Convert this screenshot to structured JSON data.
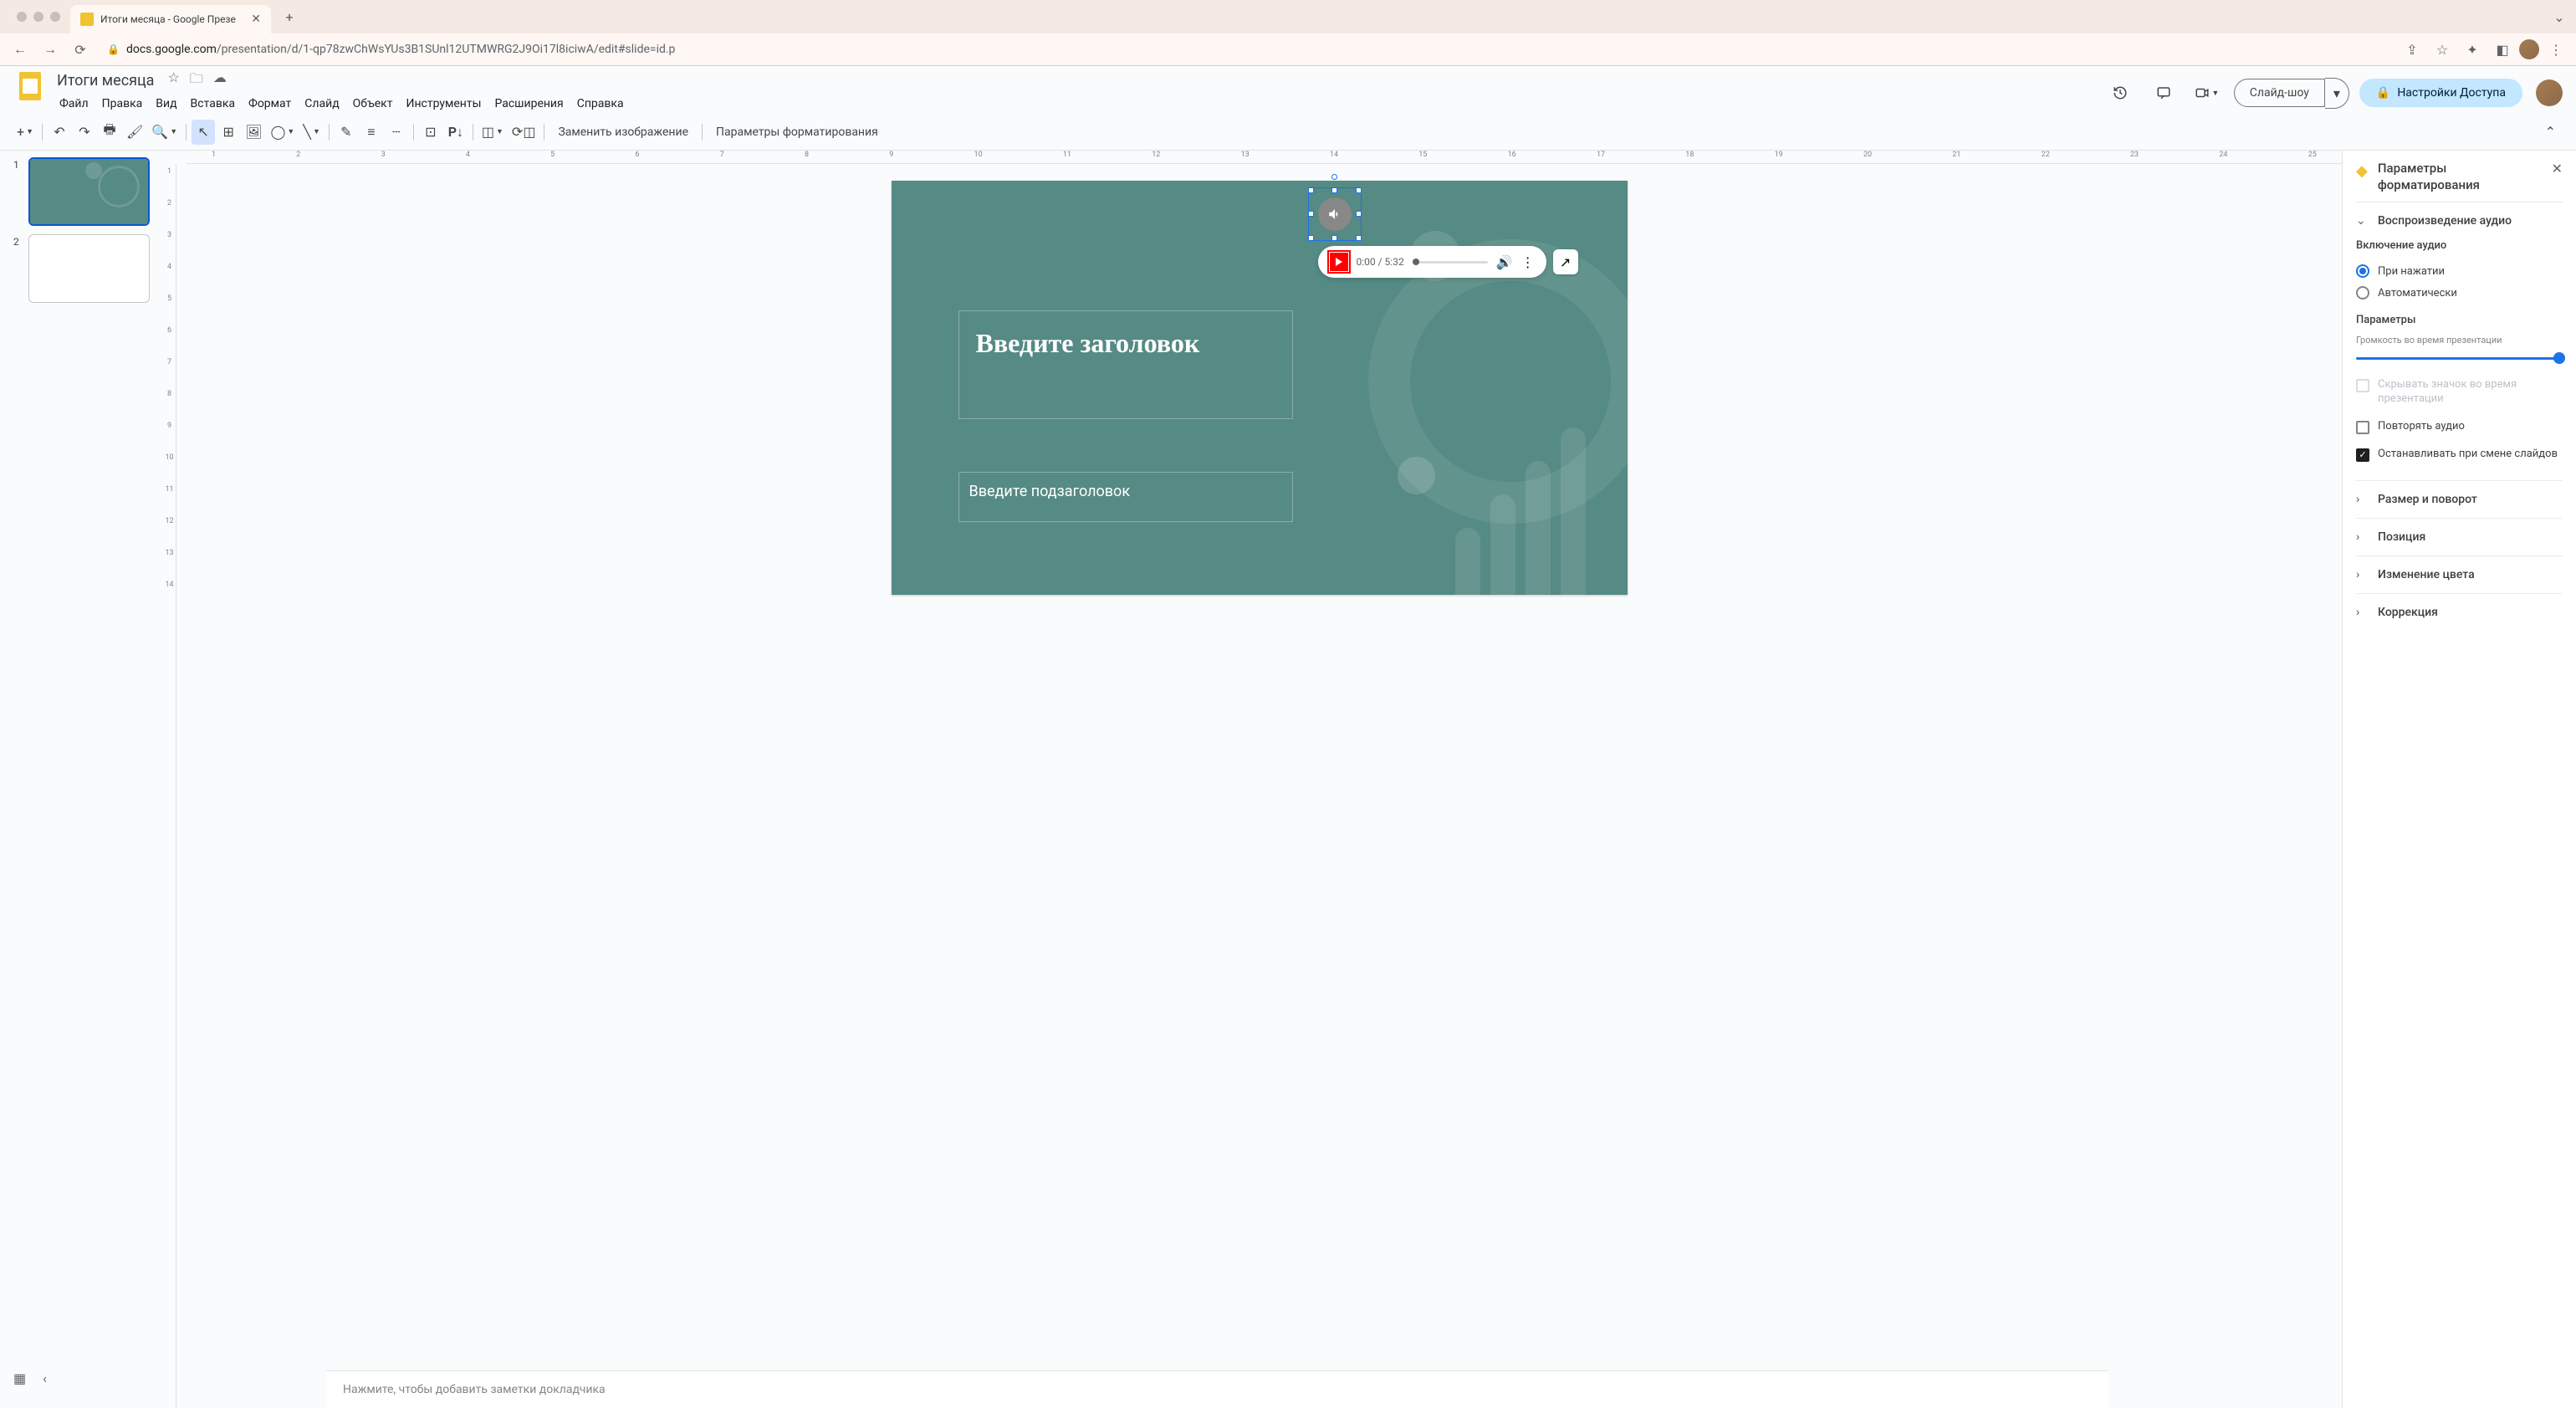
{
  "browser": {
    "tab_title": "Итоги месяца - Google Презе",
    "url_domain": "docs.google.com",
    "url_path": "/presentation/d/1-qp78zwChWsYUs3B1SUnl12UTMWRG2J9Oi17l8iciwA/edit#slide=id.p"
  },
  "header": {
    "doc_title": "Итоги месяца",
    "menus": [
      "Файл",
      "Правка",
      "Вид",
      "Вставка",
      "Формат",
      "Слайд",
      "Объект",
      "Инструменты",
      "Расширения",
      "Справка"
    ],
    "slideshow_label": "Слайд-шоу",
    "share_label": "Настройки Доступа"
  },
  "toolbar": {
    "replace_image": "Заменить изображение",
    "format_options": "Параметры форматирования"
  },
  "ruler_h": [
    "1",
    "2",
    "3",
    "4",
    "5",
    "6",
    "7",
    "8",
    "9",
    "10",
    "11",
    "12",
    "13",
    "14",
    "15",
    "16",
    "17",
    "18",
    "19",
    "20",
    "21",
    "22",
    "23",
    "24",
    "25"
  ],
  "ruler_v": [
    "1",
    "2",
    "3",
    "4",
    "5",
    "6",
    "7",
    "8",
    "9",
    "10",
    "11",
    "12",
    "13",
    "14"
  ],
  "filmstrip": {
    "slides": [
      {
        "num": "1",
        "active": true
      },
      {
        "num": "2",
        "active": false
      }
    ]
  },
  "slide": {
    "title_placeholder": "Введите заголовок",
    "subtitle_placeholder": "Введите подзаголовок"
  },
  "audio_player": {
    "current": "0:00",
    "duration": "5:32"
  },
  "speaker_notes_placeholder": "Нажмите, чтобы добавить заметки докладчика",
  "panel": {
    "title": "Параметры форматирования",
    "section_audio_playback": "Воспроизведение аудио",
    "start_heading": "Включение аудио",
    "start_on_click": "При нажатии",
    "start_auto": "Автоматически",
    "options_heading": "Параметры",
    "volume_label": "Громкость во время презентации",
    "hide_icon": "Скрывать значок во время презентации",
    "loop_audio": "Повторять аудио",
    "stop_on_change": "Останавливать при смене слайдов",
    "section_size": "Размер и поворот",
    "section_position": "Позиция",
    "section_recolor": "Изменение цвета",
    "section_adjust": "Коррекция"
  }
}
